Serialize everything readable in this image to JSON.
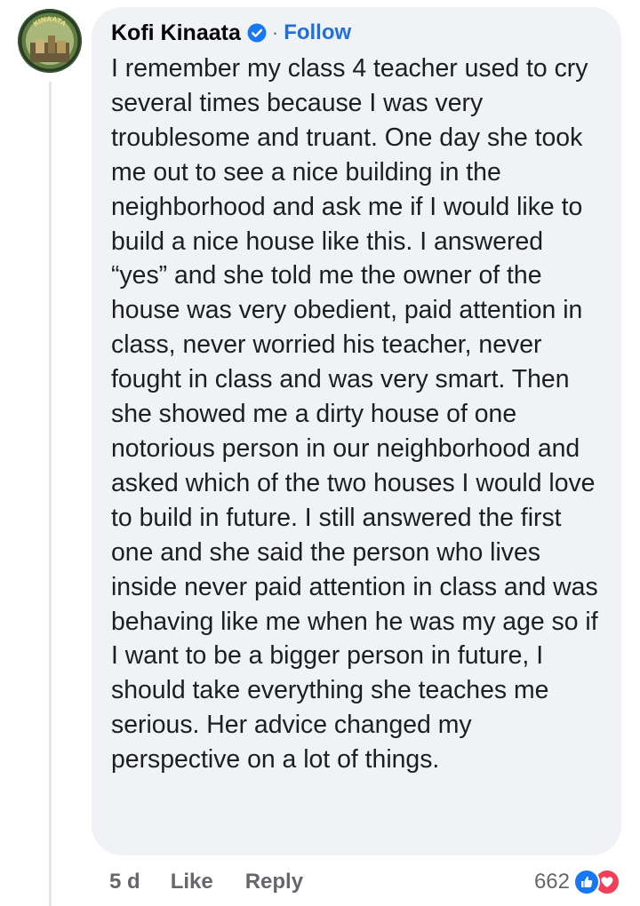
{
  "comment": {
    "author": "Kofi Kinaata",
    "verified": true,
    "separator": "·",
    "follow_label": "Follow",
    "avatar_text": "KINAATA",
    "text": "I remember my class 4 teacher used to cry several times because I was very troublesome and truant. One day she took me out to see a nice building in the neighborhood and ask me if I would like to build a nice house like this. I answered “yes” and she told me the owner of the house was very obedient, paid attention in class, never worried his teacher, never fought in class and was very smart. Then she showed me a dirty house of one notorious person in our neighborhood and asked which of the two houses I would love to build in future. I still answered the first one and she said the person who lives inside never paid attention in class and was behaving like me when he was my age so if I want to be a bigger person in future, I should take everything she teaches me serious. Her advice changed my perspective on a lot of things."
  },
  "actions": {
    "timestamp": "5 d",
    "like_label": "Like",
    "reply_label": "Reply"
  },
  "reactions": {
    "count": "662",
    "types": [
      "like-icon",
      "love-icon"
    ]
  },
  "colors": {
    "bubble_bg": "#f0f2f5",
    "follow_blue": "#216fdb",
    "verified_blue": "#1877f2",
    "like_blue": "#1877f2",
    "love_red": "#f33e58",
    "meta_gray": "#65676b"
  }
}
